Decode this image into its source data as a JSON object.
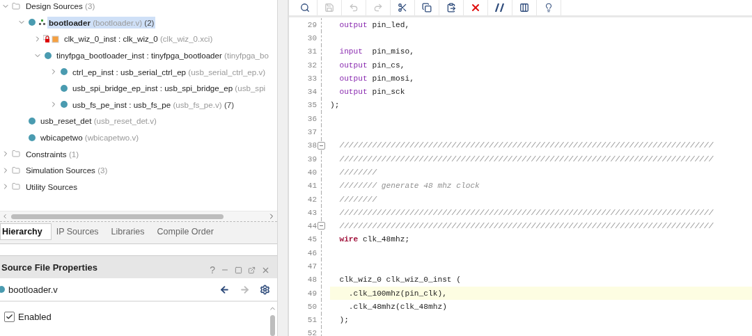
{
  "sources": {
    "tree": [
      {
        "label": "Design Sources",
        "detail": "(3)",
        "kind": "folder",
        "expanded": true,
        "selected": false,
        "children": [
          {
            "label": "bootloader",
            "detail": "(bootloader.v)",
            "count": "(2)",
            "kind": "top-module",
            "expanded": true,
            "selected": true,
            "children": [
              {
                "label": "clk_wiz_0_inst : clk_wiz_0",
                "detail": "(clk_wiz_0.xci)",
                "kind": "ip",
                "expanded": false,
                "selected": false
              },
              {
                "label": "tinyfpga_bootloader_inst : tinyfpga_bootloader",
                "detail": "(tinyfpga_bo",
                "kind": "module",
                "expanded": true,
                "selected": false,
                "children": [
                  {
                    "label": "ctrl_ep_inst : usb_serial_ctrl_ep",
                    "detail": "(usb_serial_ctrl_ep.v)",
                    "kind": "module",
                    "expanded": false,
                    "selected": false
                  },
                  {
                    "label": "usb_spi_bridge_ep_inst : usb_spi_bridge_ep",
                    "detail": "(usb_spi",
                    "kind": "module",
                    "selected": false
                  },
                  {
                    "label": "usb_fs_pe_inst : usb_fs_pe",
                    "detail": "(usb_fs_pe.v)",
                    "count": "(7)",
                    "kind": "module",
                    "expanded": false,
                    "selected": false
                  }
                ]
              }
            ]
          },
          {
            "label": "usb_reset_det",
            "detail": "(usb_reset_det.v)",
            "kind": "module",
            "selected": false
          },
          {
            "label": "wbicapetwo",
            "detail": "(wbicapetwo.v)",
            "kind": "module",
            "selected": false
          }
        ]
      },
      {
        "label": "Constraints",
        "detail": "(1)",
        "kind": "folder",
        "expanded": false,
        "selected": false
      },
      {
        "label": "Simulation Sources",
        "detail": "(3)",
        "kind": "folder",
        "expanded": false,
        "selected": false
      },
      {
        "label": "Utility Sources",
        "kind": "folder",
        "expanded": false,
        "selected": false
      }
    ],
    "tabs": [
      {
        "label": "Hierarchy",
        "selected": true
      },
      {
        "label": "IP Sources",
        "selected": false
      },
      {
        "label": "Libraries",
        "selected": false
      },
      {
        "label": "Compile Order",
        "selected": false
      }
    ]
  },
  "properties": {
    "title": "Source File Properties",
    "help": "?",
    "file": "bootloader.v",
    "back_disabled": false,
    "forward_disabled": true,
    "fields": [
      {
        "label": "Enabled",
        "checked": true
      }
    ]
  },
  "editor": {
    "toolbar": [
      {
        "kind": "search",
        "disabled": false
      },
      {
        "kind": "save",
        "disabled": true
      },
      {
        "kind": "undo",
        "disabled": true
      },
      {
        "kind": "redo",
        "disabled": true
      },
      {
        "kind": "cut",
        "disabled": false
      },
      {
        "kind": "copy",
        "disabled": false
      },
      {
        "kind": "paste",
        "disabled": false
      },
      {
        "kind": "delete",
        "disabled": false
      },
      {
        "kind": "comment",
        "disabled": false
      },
      {
        "kind": "columns",
        "disabled": false
      },
      {
        "kind": "hint",
        "disabled": false
      }
    ],
    "lines": [
      {
        "number": "29",
        "kind": "plain",
        "highlighted": false,
        "tokens": [
          {
            "kind": "keyword",
            "text": "  output"
          },
          {
            "kind": "plain",
            "text": " pin_led,"
          }
        ]
      },
      {
        "number": "30",
        "kind": "plain",
        "highlighted": false
      },
      {
        "number": "31",
        "kind": "plain",
        "highlighted": false,
        "tokens": [
          {
            "kind": "keyword",
            "text": "  input"
          },
          {
            "kind": "plain",
            "text": "  pin_miso,"
          }
        ]
      },
      {
        "number": "32",
        "kind": "plain",
        "highlighted": false,
        "tokens": [
          {
            "kind": "keyword",
            "text": "  output"
          },
          {
            "kind": "plain",
            "text": " pin_cs,"
          }
        ]
      },
      {
        "number": "33",
        "kind": "plain",
        "highlighted": false,
        "tokens": [
          {
            "kind": "keyword",
            "text": "  output"
          },
          {
            "kind": "plain",
            "text": " pin_mosi,"
          }
        ]
      },
      {
        "number": "34",
        "kind": "plain",
        "highlighted": false,
        "tokens": [
          {
            "kind": "keyword",
            "text": "  output"
          },
          {
            "kind": "plain",
            "text": " pin_sck"
          }
        ]
      },
      {
        "number": "35",
        "kind": "plain",
        "highlighted": false,
        "tokens": [
          {
            "kind": "plain",
            "text": ");"
          }
        ]
      },
      {
        "number": "36",
        "kind": "plain",
        "highlighted": false
      },
      {
        "number": "37",
        "kind": "plain",
        "highlighted": false
      },
      {
        "number": "38",
        "kind": "fold-start",
        "highlighted": false,
        "tokens": [
          {
            "kind": "comment",
            "text": "  ////////////////////////////////////////////////////////////////////////////////"
          }
        ]
      },
      {
        "number": "39",
        "kind": "plain",
        "highlighted": false,
        "tokens": [
          {
            "kind": "comment",
            "text": "  ////////////////////////////////////////////////////////////////////////////////"
          }
        ]
      },
      {
        "number": "40",
        "kind": "plain",
        "highlighted": false,
        "tokens": [
          {
            "kind": "comment",
            "text": "  ////////"
          }
        ]
      },
      {
        "number": "41",
        "kind": "plain",
        "highlighted": false,
        "tokens": [
          {
            "kind": "comment",
            "text": "  //////// generate 48 mhz clock"
          }
        ]
      },
      {
        "number": "42",
        "kind": "plain",
        "highlighted": false,
        "tokens": [
          {
            "kind": "comment",
            "text": "  ////////"
          }
        ]
      },
      {
        "number": "43",
        "kind": "plain",
        "highlighted": false,
        "tokens": [
          {
            "kind": "comment",
            "text": "  ////////////////////////////////////////////////////////////////////////////////"
          }
        ]
      },
      {
        "number": "44",
        "kind": "fold-end",
        "highlighted": false,
        "tokens": [
          {
            "kind": "comment",
            "text": "  ////////////////////////////////////////////////////////////////////////////////"
          }
        ]
      },
      {
        "number": "45",
        "kind": "plain",
        "highlighted": false,
        "tokens": [
          {
            "kind": "type",
            "text": "  wire"
          },
          {
            "kind": "plain",
            "text": " clk_48mhz;"
          }
        ]
      },
      {
        "number": "46",
        "kind": "plain",
        "highlighted": false
      },
      {
        "number": "47",
        "kind": "plain",
        "highlighted": false
      },
      {
        "number": "48",
        "kind": "plain",
        "highlighted": false,
        "tokens": [
          {
            "kind": "plain",
            "text": "  clk_wiz_0 clk_wiz_0_inst ("
          }
        ]
      },
      {
        "number": "49",
        "kind": "plain",
        "highlighted": true,
        "tokens": [
          {
            "kind": "plain",
            "text": "    .clk_100mhz(pin_clk),"
          }
        ]
      },
      {
        "number": "50",
        "kind": "plain",
        "highlighted": false,
        "tokens": [
          {
            "kind": "plain",
            "text": "    .clk_48mhz(clk_48mhz)"
          }
        ]
      },
      {
        "number": "51",
        "kind": "plain",
        "highlighted": false,
        "tokens": [
          {
            "kind": "plain",
            "text": "  );"
          }
        ]
      },
      {
        "number": "52",
        "kind": "plain",
        "highlighted": false
      }
    ]
  }
}
